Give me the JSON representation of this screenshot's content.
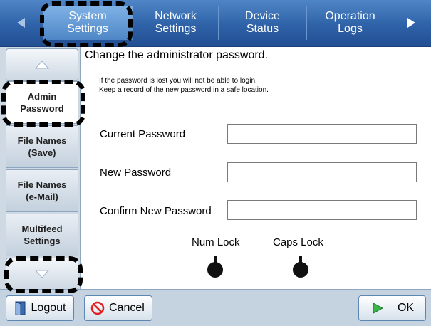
{
  "tabs": [
    {
      "label_line1": "System",
      "label_line2": "Settings",
      "active": true
    },
    {
      "label_line1": "Network",
      "label_line2": "Settings",
      "active": false
    },
    {
      "label_line1": "Device",
      "label_line2": "Status",
      "active": false
    },
    {
      "label_line1": "Operation",
      "label_line2": "Logs",
      "active": false
    }
  ],
  "sidebar": {
    "items": [
      {
        "line1": "Admin",
        "line2": "Password",
        "active": true
      },
      {
        "line1": "File Names",
        "line2": "(Save)",
        "active": false
      },
      {
        "line1": "File Names",
        "line2": "(e-Mail)",
        "active": false
      },
      {
        "line1": "Multifeed",
        "line2": "Settings",
        "active": false
      }
    ]
  },
  "main": {
    "title": "Change the administrator password.",
    "notice_line1": "If the password is lost you will not be able to login.",
    "notice_line2": "Keep a record of the new password in a safe location.",
    "fields": {
      "current": {
        "label": "Current Password",
        "value": ""
      },
      "new": {
        "label": "New Password",
        "value": ""
      },
      "confirm": {
        "label": "Confirm New Password",
        "value": ""
      }
    },
    "indicators": {
      "num_lock": {
        "label": "Num Lock",
        "state": "off"
      },
      "caps_lock": {
        "label": "Caps Lock",
        "state": "off"
      }
    }
  },
  "bottom": {
    "logout_label": "Logout",
    "cancel_label": "Cancel",
    "ok_label": "OK"
  },
  "colors": {
    "tab_bar": "#2f62a8",
    "sidebar_bg": "#cfd9e4",
    "cancel_icon": "#e02020",
    "ok_icon": "#39b54a"
  },
  "icons": {
    "tab_left": "triangle-left-icon",
    "tab_right": "triangle-right-icon",
    "side_up": "triangle-up-icon",
    "side_down": "triangle-down-icon",
    "logout": "logout-door-icon",
    "cancel": "cancel-circle-icon",
    "ok": "play-triangle-icon",
    "lock": "lock-indicator-icon"
  }
}
